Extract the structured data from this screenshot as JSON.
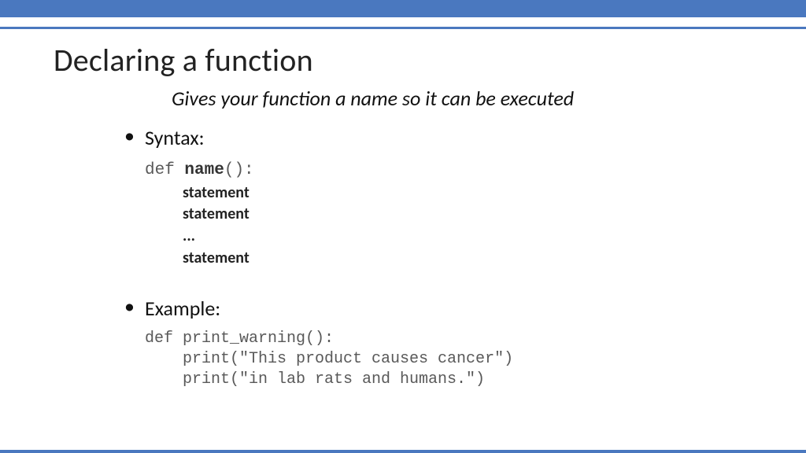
{
  "title": "Declaring a function",
  "subtitle": "Gives your function a name so it can be executed",
  "syntax": {
    "heading": "Syntax:",
    "def_kw": "def ",
    "name": "name",
    "parens": "():",
    "stmt1": "statement",
    "stmt2": "statement",
    "dots": "...",
    "stmt3": "statement"
  },
  "example": {
    "heading": "Example:",
    "line1": "def print_warning():",
    "line2": "print(\"This product causes cancer\")",
    "line3": "print(\"in lab rats and humans.\")"
  }
}
